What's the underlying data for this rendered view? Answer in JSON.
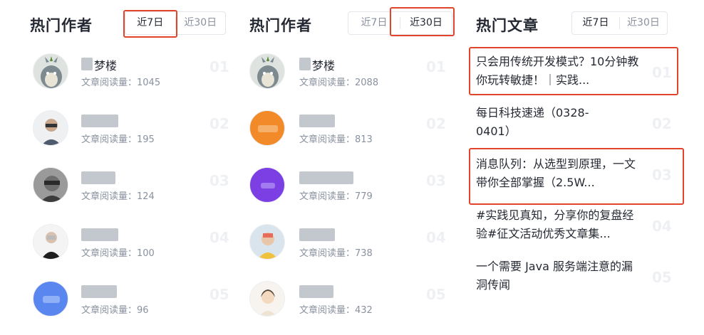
{
  "authors_7d": {
    "title": "热门作者",
    "tabs": [
      "近7日",
      "近30日"
    ],
    "items": [
      {
        "name": "梦楼",
        "reads_label": "文章阅读量：1045",
        "rank": "01"
      },
      {
        "name": "",
        "reads_label": "文章阅读量：195",
        "rank": "02"
      },
      {
        "name": "",
        "reads_label": "文章阅读量：124",
        "rank": "03"
      },
      {
        "name": "",
        "reads_label": "文章阅读量：100",
        "rank": "04"
      },
      {
        "name": "",
        "reads_label": "文章阅读量：96",
        "rank": "05"
      }
    ]
  },
  "authors_30d": {
    "title": "热门作者",
    "tabs": [
      "近7日",
      "近30日"
    ],
    "items": [
      {
        "name": "梦楼",
        "reads_label": "文章阅读量：2088",
        "rank": "01"
      },
      {
        "name": "",
        "reads_label": "文章阅读量：813",
        "rank": "02"
      },
      {
        "name": "",
        "reads_label": "文章阅读量：779",
        "rank": "03"
      },
      {
        "name": "",
        "reads_label": "文章阅读量：738",
        "rank": "04"
      },
      {
        "name": "",
        "reads_label": "文章阅读量：432",
        "rank": "05"
      }
    ]
  },
  "articles": {
    "title": "热门文章",
    "tabs": [
      "近7日",
      "近30日"
    ],
    "items": [
      {
        "title": "只会用传统开发模式？10分钟教你玩转敏捷！｜实践...",
        "rank": "01"
      },
      {
        "title": "每日科技速递（0328-0401）",
        "rank": "02"
      },
      {
        "title": "消息队列：从选型到原理，一文带你全部掌握（2.5W...",
        "rank": "03"
      },
      {
        "title": "#实践见真知，分享你的复盘经验#征文活动优秀文章集...",
        "rank": "04"
      },
      {
        "title": "一个需要 Java 服务端注意的漏洞传闻",
        "rank": "05"
      }
    ]
  },
  "colors": {
    "highlight": "#e0442b",
    "text": "#252933",
    "muted": "#8a919f"
  }
}
